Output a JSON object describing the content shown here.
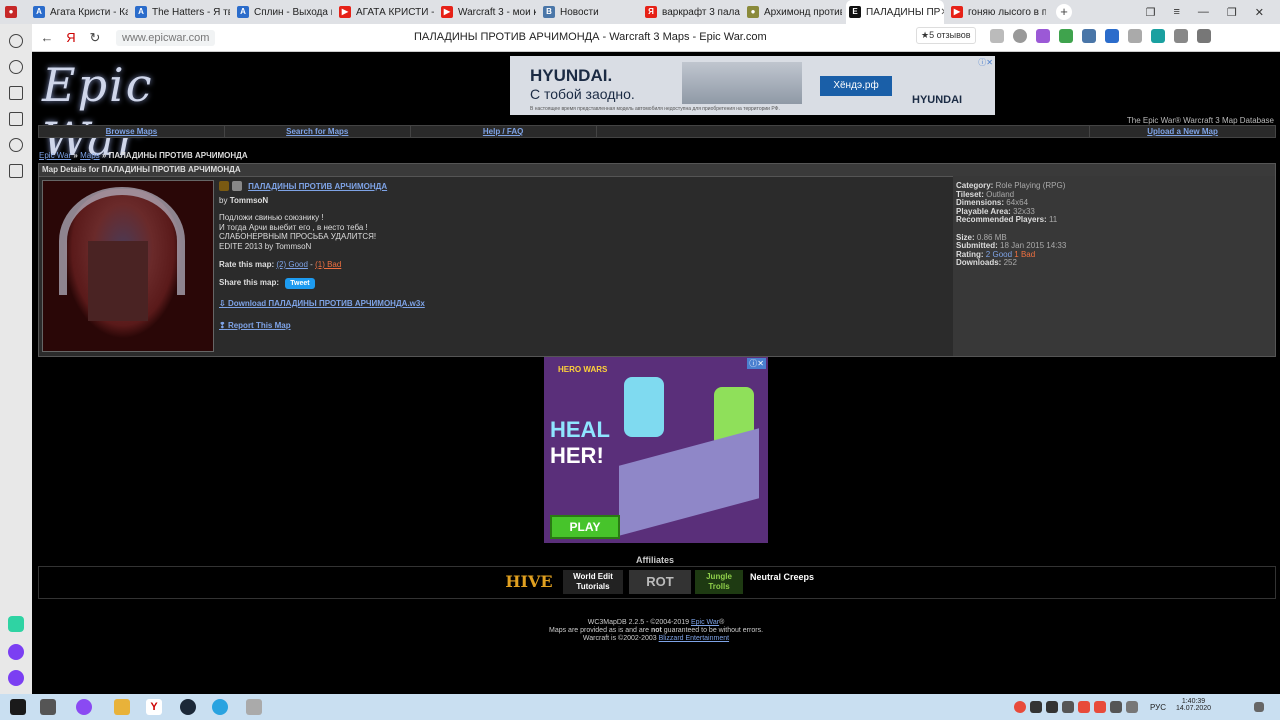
{
  "browser": {
    "tabs": [
      {
        "label": "Агата Кристи - Как",
        "icon_color": "#2b6ccb",
        "active": false
      },
      {
        "label": "The Hatters - Я тво",
        "icon_color": "#2b6ccb",
        "active": false
      },
      {
        "label": "Сплин - Выхода не",
        "icon_color": "#2b6ccb",
        "active": false
      },
      {
        "label": "АГАТА КРИСТИ - К",
        "icon_color": "#e62117",
        "active": false
      },
      {
        "label": "Warcraft 3 - мои к",
        "icon_color": "#e62117",
        "active": false
      },
      {
        "label": "Новости",
        "icon_color": "#4a76a8",
        "active": false
      },
      {
        "label": "варкрафт 3 палад",
        "icon_color": "#e62117",
        "active": false
      },
      {
        "label": "Архимонд против",
        "icon_color": "#8a8a3a",
        "active": false
      },
      {
        "label": "ПАЛАДИНЫ ПР",
        "icon_color": "#111111",
        "active": true
      },
      {
        "label": "гоняю лысого в п",
        "icon_color": "#e62117",
        "active": false
      }
    ],
    "url": "www.epicwar.com",
    "page_title": "ПАЛАДИНЫ ПРОТИВ АРЧИМОНДА - Warcraft 3 Maps - Epic War.com",
    "reviews": "★5 отзывов"
  },
  "site": {
    "logo_text": "Epic War",
    "db_title": "The Epic War® Warcraft 3 Map Database",
    "ad_top": {
      "brand": "HYUNDAI.",
      "slogan": "С тобой заодно.",
      "button": "Хёндэ.рф",
      "logo": "HYUNDAI",
      "fine_print": "В настоящее время представленная модель автомобиля недоступна для приобретения на территории РФ."
    },
    "menu": {
      "browse": "Browse Maps",
      "search": "Search for Maps",
      "help": "Help / FAQ",
      "upload": "Upload a New Map"
    },
    "breadcrumb": {
      "home": "Epic War",
      "maps": "Maps",
      "sep": "»",
      "current": "ПАЛАДИНЫ ПРОТИВ АРЧИМОНДА"
    },
    "panel_title": "Map Details for ПАЛАДИНЫ ПРОТИВ АРЧИМОНДА",
    "map": {
      "title": "ПАЛАДИНЫ ПРОТИВ АРЧИМОНДА",
      "by_label": "by",
      "author": "TommsoN",
      "desc_lines": [
        "Подложи свинью союзнику !",
        "И тогда Арчи выебит его , в несто теба !",
        "СЛАБОНЕРВНЫМ ПРОСЬБА УДАЛИТСЯ!",
        "EDITE 2013 by TommsoN"
      ],
      "rate_label": "Rate this map:",
      "good": "(2) Good",
      "dash": "-",
      "bad": "(1) Bad",
      "share_label": "Share this map:",
      "tweet": "Tweet",
      "download": "Download ПАЛАДИНЫ ПРОТИВ АРЧИМОНДА.w3x",
      "report": "Report This Map"
    },
    "stats": {
      "category_label": "Category:",
      "category": "Role Playing (RPG)",
      "tileset_label": "Tileset:",
      "tileset": "Outland",
      "dimensions_label": "Dimensions:",
      "dimensions": "64x64",
      "playable_label": "Playable Area:",
      "playable": "32x33",
      "players_label": "Recommended Players:",
      "players": "11",
      "size_label": "Size:",
      "size": "0.86 MB",
      "submitted_label": "Submitted:",
      "submitted": "18 Jan 2015 14:33",
      "rating_label": "Rating:",
      "rating_good": "2 Good",
      "rating_bad": "1 Bad",
      "downloads_label": "Downloads:",
      "downloads": "252"
    },
    "ad_mid": {
      "logo": "HERO WARS",
      "heal": "HEAL",
      "her": "HER!",
      "play": "PLAY"
    },
    "affiliates_title": "Affiliates",
    "affiliates": {
      "hive": "HIVE",
      "wet": "World Edit Tutorials",
      "rot": "ROT",
      "jungle": "Jungle Trolls",
      "neutral": "Neutral Creeps"
    },
    "footer": {
      "line1": "WC3MapDB 2.2.5 - ©2004-2019",
      "line1_link": "Epic War",
      "line1_end": "®",
      "line2_a": "Maps are provided as is and are",
      "line2_not": "not",
      "line2_b": "guaranteed to be without errors.",
      "line3": "Warcraft is ©2002-2003",
      "line3_link": "Blizzard Entertainment"
    }
  },
  "taskbar": {
    "lang": "РУС",
    "time": "1:40:39",
    "date": "14.07.2020"
  }
}
